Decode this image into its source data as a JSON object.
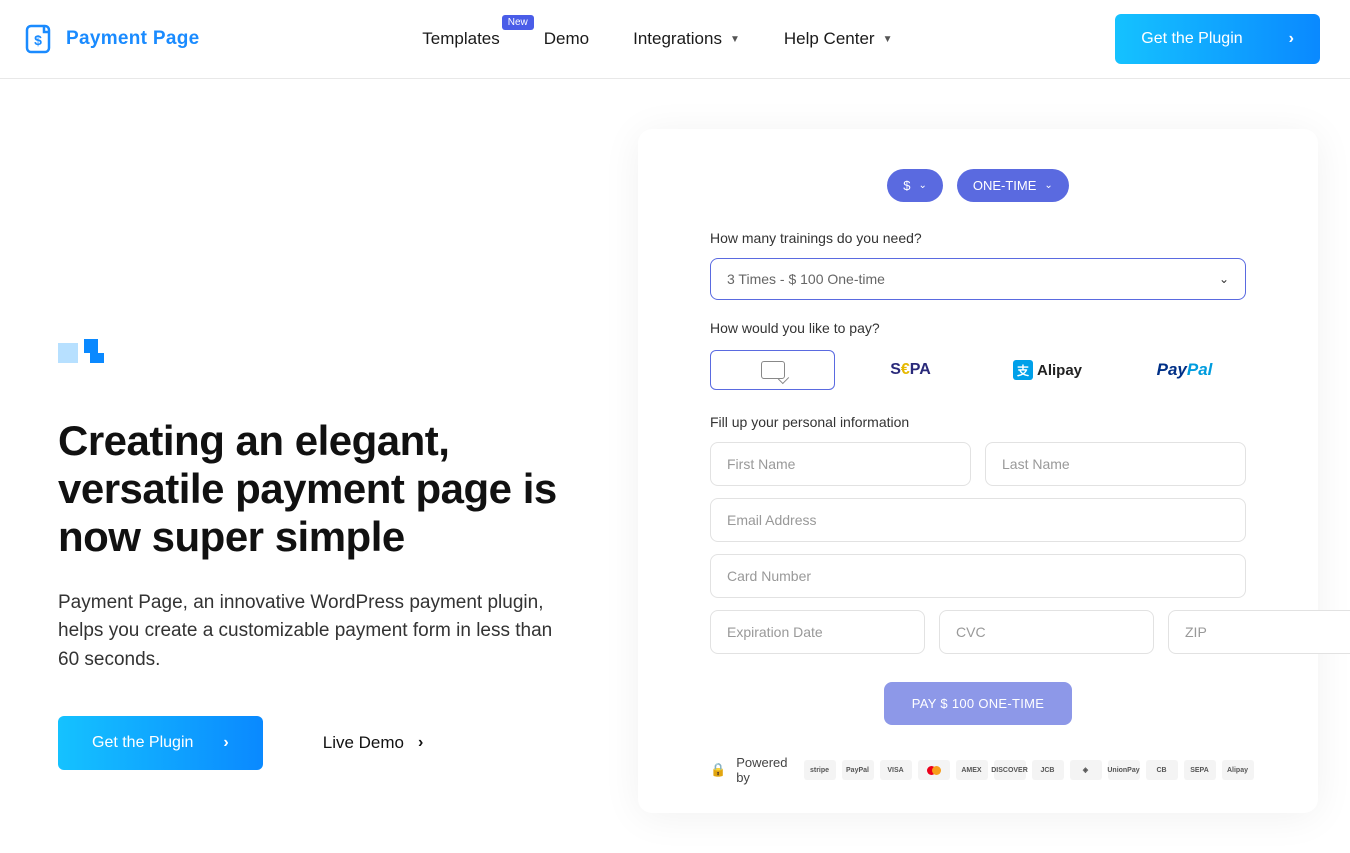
{
  "header": {
    "logo_text": "Payment Page",
    "nav": {
      "templates": "Templates",
      "templates_badge": "New",
      "demo": "Demo",
      "integrations": "Integrations",
      "help": "Help Center"
    },
    "cta": "Get the Plugin"
  },
  "hero": {
    "headline": "Creating an elegant, versatile payment page is now super simple",
    "sub": "Payment Page, an innovative WordPress payment plugin, helps you create a customizable payment form in less than 60 seconds.",
    "primary_cta": "Get the Plugin",
    "secondary_cta": "Live Demo"
  },
  "demo": {
    "currency": "$",
    "frequency": "ONE-TIME",
    "q1_label": "How many trainings do you need?",
    "q1_value": "3 Times - $ 100 One-time",
    "q2_label": "How would you like to pay?",
    "methods": {
      "sepa": "SEPA",
      "alipay": "Alipay",
      "paypal_a": "Pay",
      "paypal_b": "Pal"
    },
    "personal_label": "Fill up your personal information",
    "fields": {
      "first_name": "First Name",
      "last_name": "Last Name",
      "email": "Email Address",
      "card": "Card Number",
      "exp": "Expiration Date",
      "cvc": "CVC",
      "zip": "ZIP"
    },
    "pay_button": "PAY $ 100 ONE-TIME",
    "powered": "Powered by",
    "brands": [
      "stripe",
      "PayPal",
      "VISA",
      "",
      "AMEX",
      "DISCOVER",
      "JCB",
      "◈",
      "UnionPay",
      "CB",
      "SEPA",
      "Alipay"
    ]
  }
}
